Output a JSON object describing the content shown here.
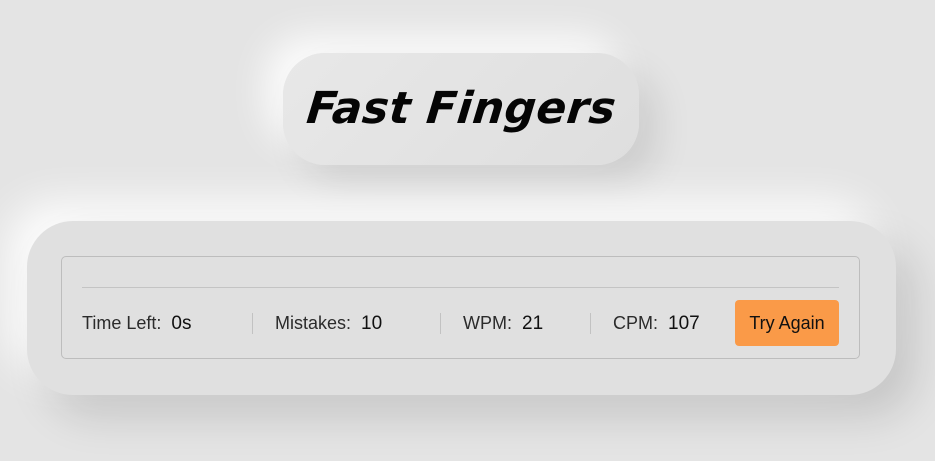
{
  "app": {
    "title": "Fast Fingers"
  },
  "typing": {
    "text": ""
  },
  "stats": {
    "time_left": {
      "label": "Time Left:",
      "value": "0",
      "unit": "s"
    },
    "mistakes": {
      "label": "Mistakes:",
      "value": "10"
    },
    "wpm": {
      "label": "WPM:",
      "value": "21"
    },
    "cpm": {
      "label": "CPM:",
      "value": "107"
    }
  },
  "actions": {
    "try_again_label": "Try Again"
  },
  "colors": {
    "background": "#e4e4e4",
    "card": "#e0e0e0",
    "accent": "#fa9a48"
  }
}
